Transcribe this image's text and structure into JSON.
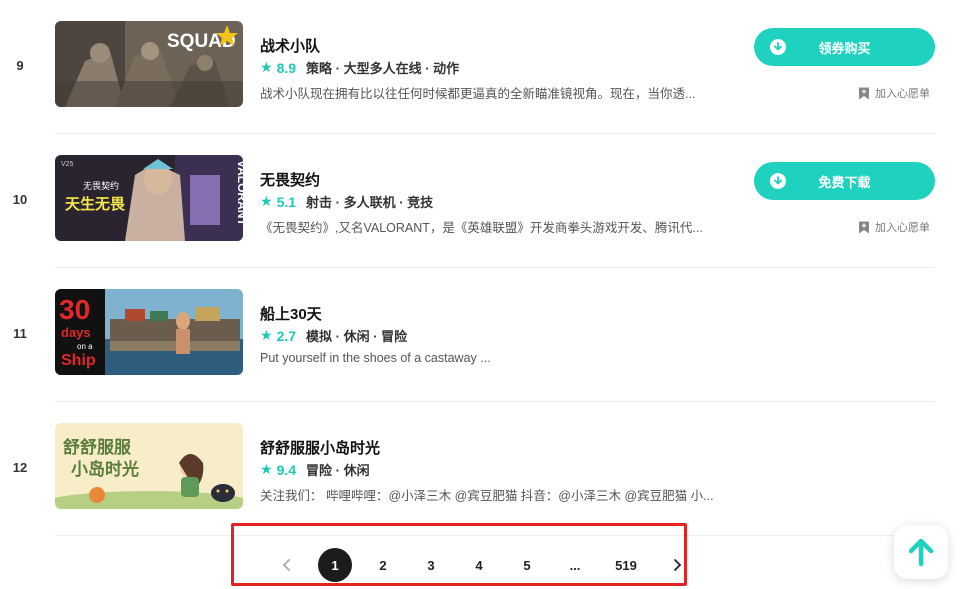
{
  "games": [
    {
      "rank": "9",
      "title": "战术小队",
      "score": "8.9",
      "tags": "策略 · 大型多人在线 · 动作",
      "desc": "战术小队现在拥有比以往任何时候都更逼真的全新瞄准镜视角。现在，当你透...",
      "thumb_text": "SQUAD",
      "action_label": "领券购买",
      "wishlist_label": "加入心愿单"
    },
    {
      "rank": "10",
      "title": "无畏契约",
      "score": "5.1",
      "tags": "射击 · 多人联机 · 竞技",
      "desc": "《无畏契约》,又名VALORANT，是《英雄联盟》开发商拳头游戏开发、腾讯代...",
      "thumb_text": "天生无畏",
      "thumb_small": "无畏契约",
      "thumb_side": "VALORANT",
      "thumb_corner": "V25",
      "action_label": "免费下载",
      "wishlist_label": "加入心愿单"
    },
    {
      "rank": "11",
      "title": "船上30天",
      "score": "2.7",
      "tags": "模拟 · 休闲 · 冒险",
      "desc": "Put yourself in the shoes of a castaway ...",
      "thumb_text_1": "30",
      "thumb_text_2": "days",
      "thumb_text_3": "on a",
      "thumb_text_4": "Ship"
    },
    {
      "rank": "12",
      "title": "舒舒服服小岛时光",
      "score": "9.4",
      "tags": "冒险 · 休闲",
      "desc": "关注我们： 哔哩哔哩：@小泽三木 @宾豆肥猫 抖音：@小泽三木 @宾豆肥猫 小...",
      "thumb_line1": "舒舒服服",
      "thumb_line2": "小岛时光"
    }
  ],
  "pagination": {
    "pages": [
      "1",
      "2",
      "3",
      "4",
      "5",
      "...",
      "519"
    ],
    "current": "1"
  },
  "icons": {
    "star": "star-icon",
    "download": "download-icon",
    "bookmark": "bookmark-icon",
    "prev": "chevron-left-icon",
    "next": "chevron-right-icon",
    "back_to_top": "arrow-up-icon"
  },
  "colors": {
    "accent": "#1fd1bf",
    "highlight_box": "#e52323",
    "active_page": "#1c1c1c"
  }
}
